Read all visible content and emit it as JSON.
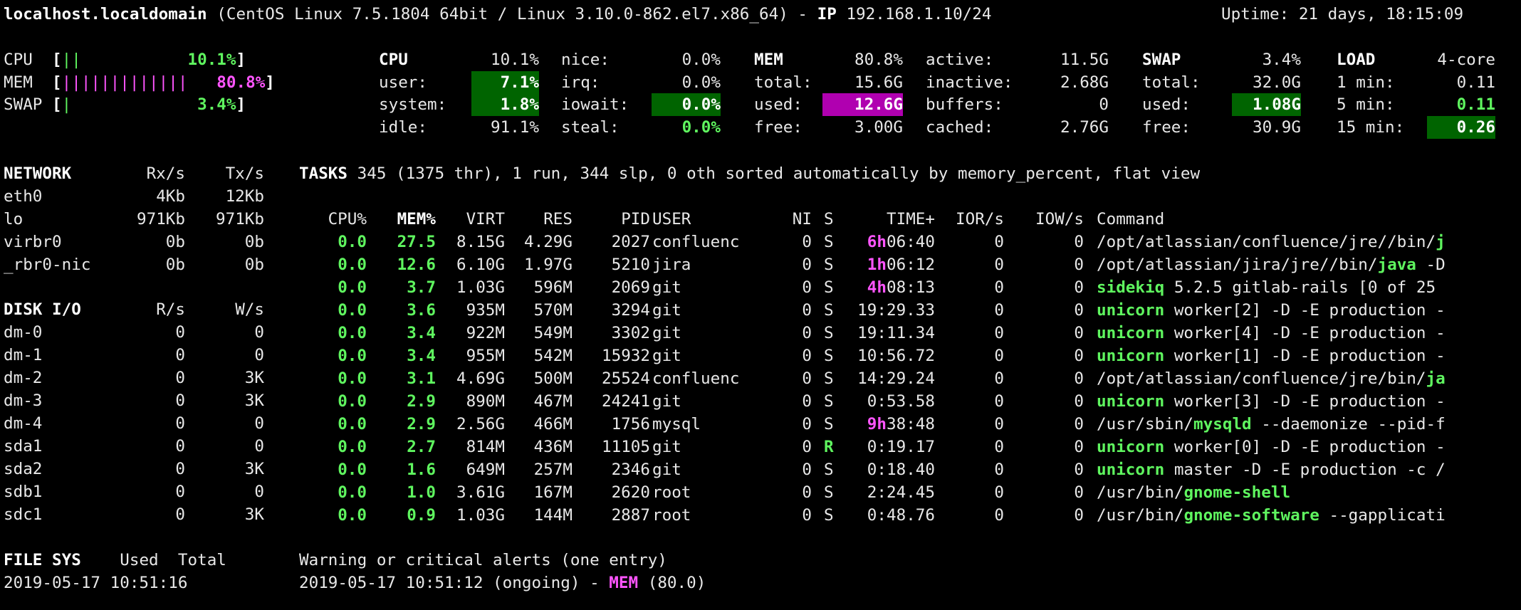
{
  "header": {
    "hostname": "localhost.localdomain",
    "os": " (CentOS Linux 7.5.1804 64bit / Linux 3.10.0-862.el7.x86_64) - ",
    "ip_label": "IP",
    "ip": " 192.168.1.10/24",
    "uptime": "Uptime: 21 days, 18:15:09"
  },
  "quicklook": {
    "cpu": {
      "label": "CPU  ",
      "bar": "||",
      "pad": "           ",
      "value": "10.1%"
    },
    "mem": {
      "label": "MEM  ",
      "bar": "|||||||||||||",
      "pad": "   ",
      "value": "80.8%"
    },
    "swap": {
      "label": "SWAP ",
      "bar": "|",
      "pad": "             ",
      "value": "3.4%"
    }
  },
  "cpu": {
    "title": "CPU",
    "total": "10.1%",
    "user_label": "user:",
    "user": "7.1%",
    "system_label": "system:",
    "system": "1.8%",
    "idle_label": "idle:",
    "idle": "91.1%",
    "nice_label": "nice:",
    "nice": "0.0%",
    "irq_label": "irq:",
    "irq": "0.0%",
    "iowait_label": "iowait:",
    "iowait": "0.0%",
    "steal_label": "steal:",
    "steal": "0.0%"
  },
  "mem": {
    "title": "MEM",
    "percent": "80.8%",
    "total_label": "total:",
    "total": "15.6G",
    "used_label": "used:",
    "used": "12.6G",
    "free_label": "free:",
    "free": "3.00G",
    "active_label": "active:",
    "active": "11.5G",
    "inactive_label": "inactive:",
    "inactive": "2.68G",
    "buffers_label": "buffers:",
    "buffers": "0",
    "cached_label": "cached:",
    "cached": "2.76G"
  },
  "swap": {
    "title": "SWAP",
    "percent": "3.4%",
    "total_label": "total:",
    "total": "32.0G",
    "used_label": "used:",
    "used": "1.08G",
    "free_label": "free:",
    "free": "30.9G"
  },
  "load": {
    "title": "LOAD",
    "cores": "4-core",
    "min1_label": "1 min:",
    "min1": "0.11",
    "min5_label": "5 min:",
    "min5": "0.11",
    "min15_label": "15 min:",
    "min15": "0.26"
  },
  "network": {
    "title": "NETWORK",
    "rx_header": "Rx/s",
    "tx_header": "Tx/s",
    "rows": [
      {
        "name": "eth0",
        "rx": "4Kb",
        "tx": "12Kb"
      },
      {
        "name": "lo",
        "rx": "971Kb",
        "tx": "971Kb"
      },
      {
        "name": "virbr0",
        "rx": "0b",
        "tx": "0b"
      },
      {
        "name": "_rbr0-nic",
        "rx": "0b",
        "tx": "0b"
      }
    ]
  },
  "diskio": {
    "title": "DISK I/O",
    "r_header": "R/s",
    "w_header": "W/s",
    "rows": [
      {
        "name": "dm-0",
        "r": "0",
        "w": "0"
      },
      {
        "name": "dm-1",
        "r": "0",
        "w": "0"
      },
      {
        "name": "dm-2",
        "r": "0",
        "w": "3K"
      },
      {
        "name": "dm-3",
        "r": "0",
        "w": "3K"
      },
      {
        "name": "dm-4",
        "r": "0",
        "w": "0"
      },
      {
        "name": "sda1",
        "r": "0",
        "w": "0"
      },
      {
        "name": "sda2",
        "r": "0",
        "w": "3K"
      },
      {
        "name": "sdb1",
        "r": "0",
        "w": "0"
      },
      {
        "name": "sdc1",
        "r": "0",
        "w": "3K"
      }
    ]
  },
  "tasks": {
    "title": "TASKS",
    "summary": " 345 (1375 thr), 1 run, 344 slp, 0 oth sorted automatically by memory_percent, flat view",
    "headers": {
      "cpu": "CPU%",
      "mem": "MEM%",
      "virt": "VIRT",
      "res": "RES",
      "pid": "PID",
      "user": "USER",
      "ni": "NI",
      "s": "S",
      "time": "TIME+",
      "ior": "IOR/s",
      "iow": "IOW/s",
      "cmd": "Command"
    },
    "rows": [
      {
        "cpu": "0.0",
        "mem": "27.5",
        "virt": "8.15G",
        "res": "4.29G",
        "pid": "2027",
        "user": "confluenc",
        "ni": "0",
        "s": "S",
        "time_h": "6h",
        "time": "06:40",
        "ior": "0",
        "iow": "0",
        "cmd_pre": "/opt/atlassian/confluence/jre//bin/",
        "cmd_hl": "j",
        "cmd_post": ""
      },
      {
        "cpu": "0.0",
        "mem": "12.6",
        "virt": "6.10G",
        "res": "1.97G",
        "pid": "5210",
        "user": "jira",
        "ni": "0",
        "s": "S",
        "time_h": "1h",
        "time": "06:12",
        "ior": "0",
        "iow": "0",
        "cmd_pre": "/opt/atlassian/jira/jre//bin/",
        "cmd_hl": "java",
        "cmd_post": " -D"
      },
      {
        "cpu": "0.0",
        "mem": "3.7",
        "virt": "1.03G",
        "res": "596M",
        "pid": "2069",
        "user": "git",
        "ni": "0",
        "s": "S",
        "time_h": "4h",
        "time": "08:13",
        "ior": "0",
        "iow": "0",
        "cmd_pre": "",
        "cmd_hl": "sidekiq",
        "cmd_post": " 5.2.5 gitlab-rails [0 of 25"
      },
      {
        "cpu": "0.0",
        "mem": "3.6",
        "virt": "935M",
        "res": "570M",
        "pid": "3294",
        "user": "git",
        "ni": "0",
        "s": "S",
        "time_h": "",
        "time": "19:29.33",
        "ior": "0",
        "iow": "0",
        "cmd_pre": "",
        "cmd_hl": "unicorn",
        "cmd_post": " worker[2] -D -E production -"
      },
      {
        "cpu": "0.0",
        "mem": "3.4",
        "virt": "922M",
        "res": "549M",
        "pid": "3302",
        "user": "git",
        "ni": "0",
        "s": "S",
        "time_h": "",
        "time": "19:11.34",
        "ior": "0",
        "iow": "0",
        "cmd_pre": "",
        "cmd_hl": "unicorn",
        "cmd_post": " worker[4] -D -E production -"
      },
      {
        "cpu": "0.0",
        "mem": "3.4",
        "virt": "955M",
        "res": "542M",
        "pid": "15932",
        "user": "git",
        "ni": "0",
        "s": "S",
        "time_h": "",
        "time": "10:56.72",
        "ior": "0",
        "iow": "0",
        "cmd_pre": "",
        "cmd_hl": "unicorn",
        "cmd_post": " worker[1] -D -E production -"
      },
      {
        "cpu": "0.0",
        "mem": "3.1",
        "virt": "4.69G",
        "res": "500M",
        "pid": "25524",
        "user": "confluenc",
        "ni": "0",
        "s": "S",
        "time_h": "",
        "time": "14:29.24",
        "ior": "0",
        "iow": "0",
        "cmd_pre": "/opt/atlassian/confluence/jre/bin/",
        "cmd_hl": "ja",
        "cmd_post": ""
      },
      {
        "cpu": "0.0",
        "mem": "2.9",
        "virt": "890M",
        "res": "467M",
        "pid": "24241",
        "user": "git",
        "ni": "0",
        "s": "S",
        "time_h": "",
        "time": "0:53.58",
        "ior": "0",
        "iow": "0",
        "cmd_pre": "",
        "cmd_hl": "unicorn",
        "cmd_post": " worker[3] -D -E production -"
      },
      {
        "cpu": "0.0",
        "mem": "2.9",
        "virt": "2.56G",
        "res": "466M",
        "pid": "1756",
        "user": "mysql",
        "ni": "0",
        "s": "S",
        "time_h": "9h",
        "time": "38:48",
        "ior": "0",
        "iow": "0",
        "cmd_pre": "/usr/sbin/",
        "cmd_hl": "mysqld",
        "cmd_post": " --daemonize --pid-f"
      },
      {
        "cpu": "0.0",
        "mem": "2.7",
        "virt": "814M",
        "res": "436M",
        "pid": "11105",
        "user": "git",
        "ni": "0",
        "s": "R",
        "time_h": "",
        "time": "0:19.17",
        "ior": "0",
        "iow": "0",
        "cmd_pre": "",
        "cmd_hl": "unicorn",
        "cmd_post": " worker[0] -D -E production -"
      },
      {
        "cpu": "0.0",
        "mem": "1.6",
        "virt": "649M",
        "res": "257M",
        "pid": "2346",
        "user": "git",
        "ni": "0",
        "s": "S",
        "time_h": "",
        "time": "0:18.40",
        "ior": "0",
        "iow": "0",
        "cmd_pre": "",
        "cmd_hl": "unicorn",
        "cmd_post": " master -D -E production -c /"
      },
      {
        "cpu": "0.0",
        "mem": "1.0",
        "virt": "3.61G",
        "res": "167M",
        "pid": "2620",
        "user": "root",
        "ni": "0",
        "s": "S",
        "time_h": "",
        "time": "2:24.45",
        "ior": "0",
        "iow": "0",
        "cmd_pre": "/usr/bin/",
        "cmd_hl": "gnome-shell",
        "cmd_post": ""
      },
      {
        "cpu": "0.0",
        "mem": "0.9",
        "virt": "1.03G",
        "res": "144M",
        "pid": "2887",
        "user": "root",
        "ni": "0",
        "s": "S",
        "time_h": "",
        "time": "0:48.76",
        "ior": "0",
        "iow": "0",
        "cmd_pre": "/usr/bin/",
        "cmd_hl": "gnome-software",
        "cmd_post": " --gapplicati"
      }
    ]
  },
  "filesys": {
    "title": "FILE SYS",
    "used_header": "Used",
    "total_header": "Total"
  },
  "alerts": {
    "title": "Warning or critical alerts (one entry)",
    "entry_prefix": "2019-05-17 10:51:12 (ongoing) - ",
    "entry_metric": "MEM",
    "entry_value": " (80.0)"
  },
  "footer": {
    "datetime": "2019-05-17 10:51:16"
  },
  "colors": {
    "ok_green": "#5ff55f",
    "critical_magenta": "#ff55ff",
    "ok_bg": "#006400",
    "critical_bg": "#b000b0"
  }
}
